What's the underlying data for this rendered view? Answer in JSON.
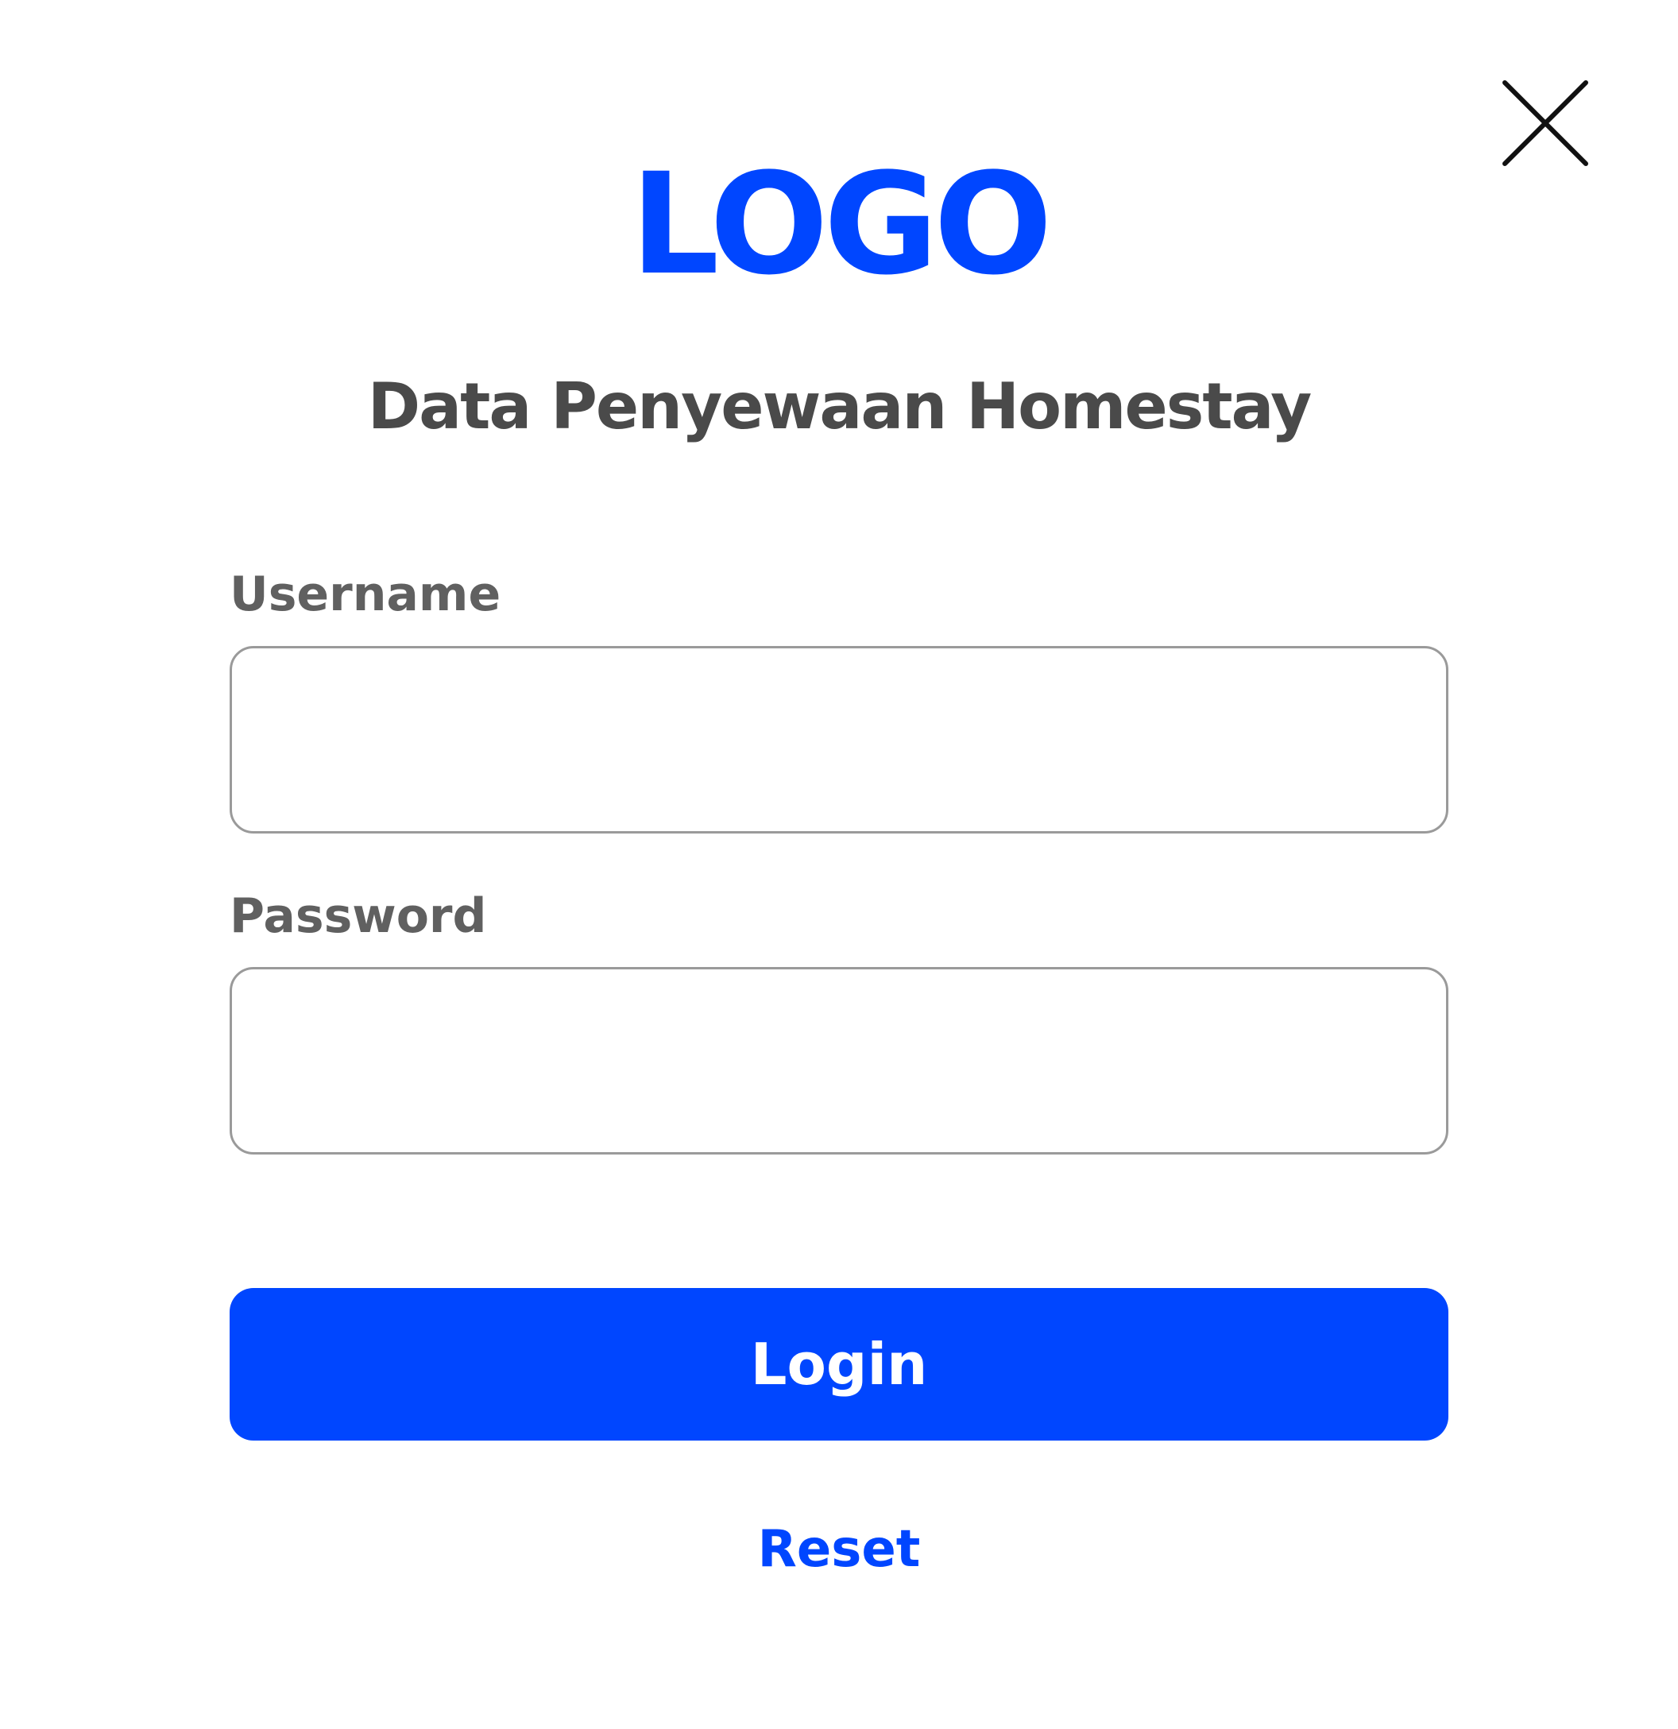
{
  "header": {
    "close_icon": "close-icon",
    "logo_text": "LOGO",
    "title": "Data Penyewaan Homestay"
  },
  "form": {
    "username_label": "Username",
    "username_value": "",
    "password_label": "Password",
    "password_value": "",
    "login_label": "Login",
    "reset_label": "Reset"
  },
  "colors": {
    "accent": "#0046ff",
    "title_text": "#4a4a4a",
    "label_text": "#606060",
    "input_border": "#9a9a9a",
    "background": "#ffffff"
  }
}
